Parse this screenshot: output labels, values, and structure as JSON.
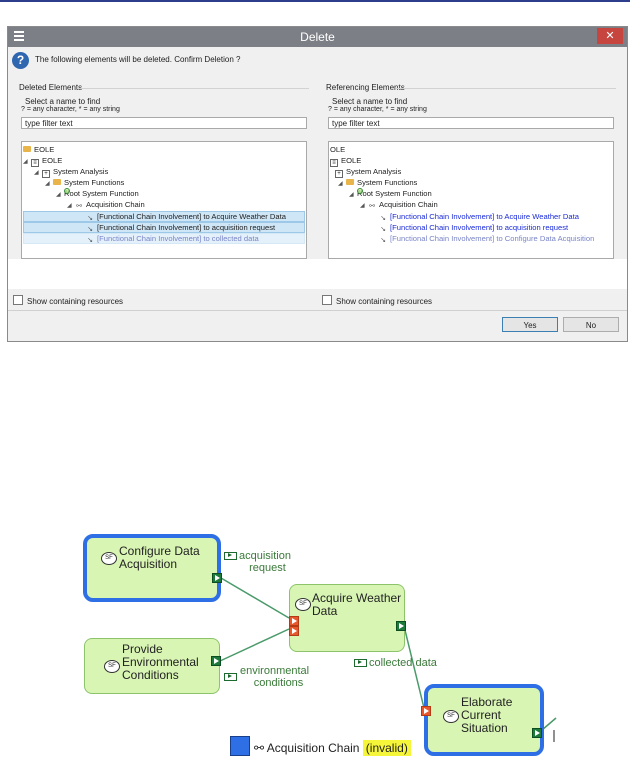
{
  "dialog": {
    "title": "Delete",
    "close_label": "✕",
    "message": "The following elements will be deleted. Confirm Deletion ?",
    "yes_label": "Yes",
    "no_label": "No"
  },
  "left_pane": {
    "group_label": "Deleted Elements",
    "hint1": "Select a name to find",
    "hint2": "? = any character, * = any string",
    "filter_value": "type filter text",
    "show_containing": "Show containing resources",
    "tree": [
      "EOLE",
      "EOLE",
      "System Analysis",
      "System Functions",
      "Root System Function",
      "Acquisition Chain",
      "[Functional Chain Involvement] to Acquire Weather Data",
      "[Functional Chain Involvement] to acquisition request",
      "[Functional Chain Involvement] to collected data"
    ]
  },
  "right_pane": {
    "group_label": "Referencing Elements",
    "hint1": "Select a name to find",
    "hint2": "? = any character, * = any string",
    "filter_value": "type filter text",
    "show_containing": "Show containing resources",
    "tree": [
      "OLE",
      "EOLE",
      "System Analysis",
      "System Functions",
      "Root System Function",
      "Acquisition Chain",
      "[Functional Chain Involvement] to Acquire Weather Data",
      "[Functional Chain Involvement] to acquisition request",
      "[Functional Chain Involvement] to Configure Data Acquisition"
    ]
  },
  "diagram": {
    "functions": {
      "configure": [
        "Configure Data",
        "Acquisition"
      ],
      "acquire": [
        "Acquire Weather",
        "Data"
      ],
      "provide": [
        "Provide",
        "Environmental",
        "Conditions"
      ],
      "elaborate": [
        "Elaborate",
        "Current",
        "Situation"
      ]
    },
    "function_tag": "SF",
    "exchanges": {
      "acquisition_request": [
        "acquisition",
        "request"
      ],
      "environmental_conditions": [
        "environmental",
        "conditions"
      ],
      "collected_data": "collected data"
    },
    "legend": {
      "chain_name": "Acquisition Chain",
      "status": "(invalid)"
    },
    "colors": {
      "selection": "#2f6fe6",
      "function_fill": "#d8f5b4",
      "link": "#4a9a6a",
      "invalid_highlight": "#f5f53a"
    }
  }
}
